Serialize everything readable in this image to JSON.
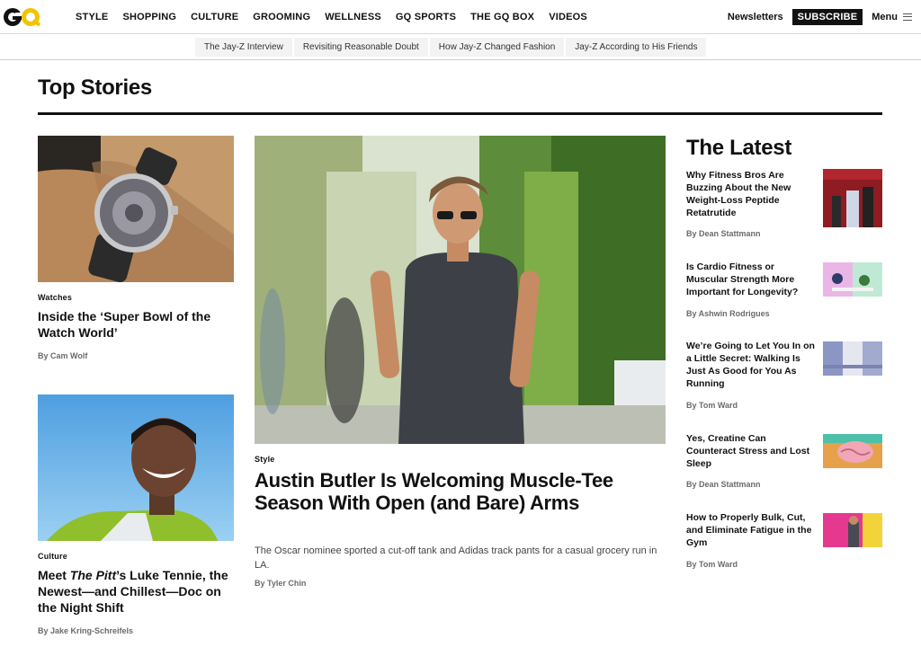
{
  "brand": {
    "logo_text": "GQ",
    "accent": "#f1c400"
  },
  "topnav": {
    "links": [
      "STYLE",
      "SHOPPING",
      "CULTURE",
      "GROOMING",
      "WELLNESS",
      "GQ SPORTS",
      "THE GQ BOX",
      "VIDEOS"
    ],
    "newsletters": "Newsletters",
    "subscribe": "SUBSCRIBE",
    "menu": "Menu"
  },
  "subnav": {
    "items": [
      "The Jay-Z Interview",
      "Revisiting Reasonable Doubt",
      "How Jay-Z Changed Fashion",
      "Jay-Z According to His Friends"
    ]
  },
  "top_stories": {
    "title": "Top Stories",
    "left_cards": [
      {
        "kicker": "Watches",
        "headline": "Inside the ‘Super Bowl of the Watch World’",
        "byline": "By Cam Wolf",
        "image": "wristwatch-on-wrist"
      },
      {
        "kicker": "Culture",
        "headline_pre": "Meet ",
        "headline_italic": "The Pitt",
        "headline_post": "’s Luke Tennie, the Newest—and Chillest—Doc on the Night Shift",
        "byline": "By Jake Kring-Schreifels",
        "image": "smiling-man-portrait"
      }
    ],
    "hero": {
      "kicker": "Style",
      "headline": "Austin Butler Is Welcoming Muscle-Tee Season With Open (and Bare) Arms",
      "dek": "The Oscar nominee sported a cut-off tank and Adidas track pants for a casual grocery run in LA.",
      "byline": "By Tyler Chin",
      "image": "man-in-sleeveless-tee-walking"
    }
  },
  "latest": {
    "title": "The Latest",
    "items": [
      {
        "headline": "Why Fitness Bros Are Buzzing About the New Weight-Loss Peptide Retatrutide",
        "byline": "By Dean Stattmann",
        "image": "red-curtain-bottles"
      },
      {
        "headline": "Is Cardio Fitness or Muscular Strength More Important for Longevity?",
        "byline": "By Ashwin Rodrigues",
        "image": "illustrated-runners"
      },
      {
        "headline": "We’re Going to Let You In on a Little Secret: Walking Is Just As Good for You As Running",
        "byline": "By Tom Ward",
        "image": "walkers-illustration"
      },
      {
        "headline": "Yes, Creatine Can Counteract Stress and Lost Sleep",
        "byline": "By Dean Stattmann",
        "image": "brain-illustration"
      },
      {
        "headline": "How to Properly Bulk, Cut, and Eliminate Fatigue in the Gym",
        "byline": "By Tom Ward",
        "image": "athlete-pink-background"
      }
    ]
  }
}
